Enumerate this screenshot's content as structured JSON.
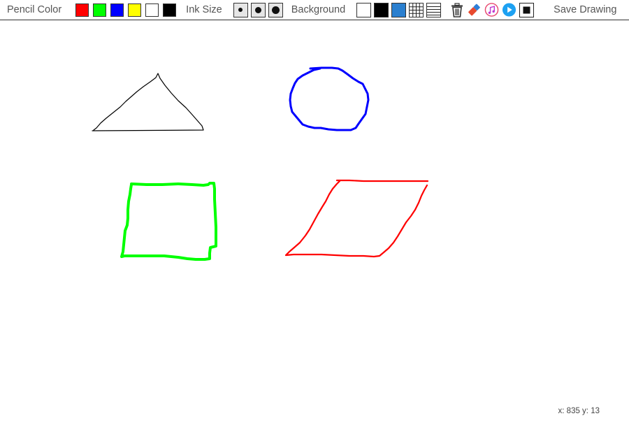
{
  "toolbar": {
    "pencil_color_label": "Pencil Color",
    "pencil_colors": [
      {
        "name": "red",
        "hex": "#ff0000"
      },
      {
        "name": "green",
        "hex": "#00ff00"
      },
      {
        "name": "blue",
        "hex": "#0000ff"
      },
      {
        "name": "yellow",
        "hex": "#ffff00"
      },
      {
        "name": "white",
        "hex": "#ffffff"
      },
      {
        "name": "black",
        "hex": "#000000"
      }
    ],
    "ink_size_label": "Ink Size",
    "ink_sizes": [
      "small",
      "medium",
      "large"
    ],
    "background_label": "Background",
    "backgrounds": [
      {
        "name": "white",
        "hex": "#ffffff"
      },
      {
        "name": "black",
        "hex": "#000000"
      },
      {
        "name": "blue",
        "hex": "#2a7fcf"
      },
      {
        "name": "grid",
        "icon": "grid-icon"
      },
      {
        "name": "lined",
        "icon": "lines-icon"
      }
    ],
    "tools": [
      "trash-icon",
      "eraser-icon",
      "music-icon",
      "play-icon",
      "stop-icon"
    ],
    "save_label": "Save Drawing"
  },
  "canvas": {
    "strokes": [
      {
        "name": "triangle",
        "color": "#000000"
      },
      {
        "name": "circle",
        "color": "#0000ff"
      },
      {
        "name": "square",
        "color": "#00ff00"
      },
      {
        "name": "parallelogram",
        "color": "#ff0000"
      }
    ]
  },
  "status": {
    "coords": "x: 835 y: 13"
  }
}
